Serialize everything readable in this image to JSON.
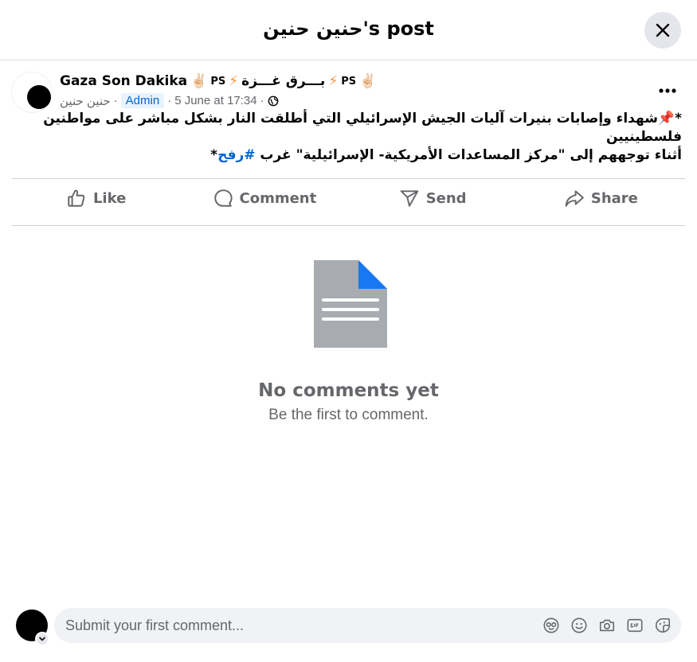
{
  "dialog": {
    "title": "حنين حنين's post"
  },
  "post": {
    "author": "Gaza Son Dakika",
    "author_decor_a": "✌🏻",
    "author_ps_a": "PS",
    "author_bolt_a": "⚡",
    "author_arabic": "بـــرق غـــزة",
    "author_bolt_b": "⚡",
    "author_ps_b": "PS",
    "author_decor_b": "✌🏻",
    "member_name": "حنين حنين",
    "role_badge": "Admin",
    "timestamp": "5 June at 17:34",
    "separator": "·",
    "text_line1": "*📌شهداء وإصابات بنيرات آليات الجيش الإسرائيلي التي أطلقت النار بشكل مباشر على مواطنين فلسطينيين",
    "text_line2_prefix": "أثناء توجههم إلى \"مركز المساعدات الأمريكية- الإسرائيلية\" غرب ",
    "hashtag": "#رفح",
    "text_line2_suffix": "*"
  },
  "actions": [
    {
      "label": "Like",
      "icon": "like-icon"
    },
    {
      "label": "Comment",
      "icon": "comment-icon"
    },
    {
      "label": "Send",
      "icon": "send-icon"
    },
    {
      "label": "Share",
      "icon": "share-icon"
    }
  ],
  "comments": {
    "empty_title": "No comments yet",
    "empty_subtitle": "Be the first to comment."
  },
  "composer": {
    "placeholder": "Submit your first comment...",
    "icons": [
      "avatar-sticker-icon",
      "emoji-icon",
      "camera-icon",
      "gif-icon",
      "sticker-icon"
    ]
  },
  "colors": {
    "accent": "#0064d1",
    "muted_text": "#65676b",
    "doc_gray": "#a8abaf",
    "doc_corner": "#1877f2"
  }
}
